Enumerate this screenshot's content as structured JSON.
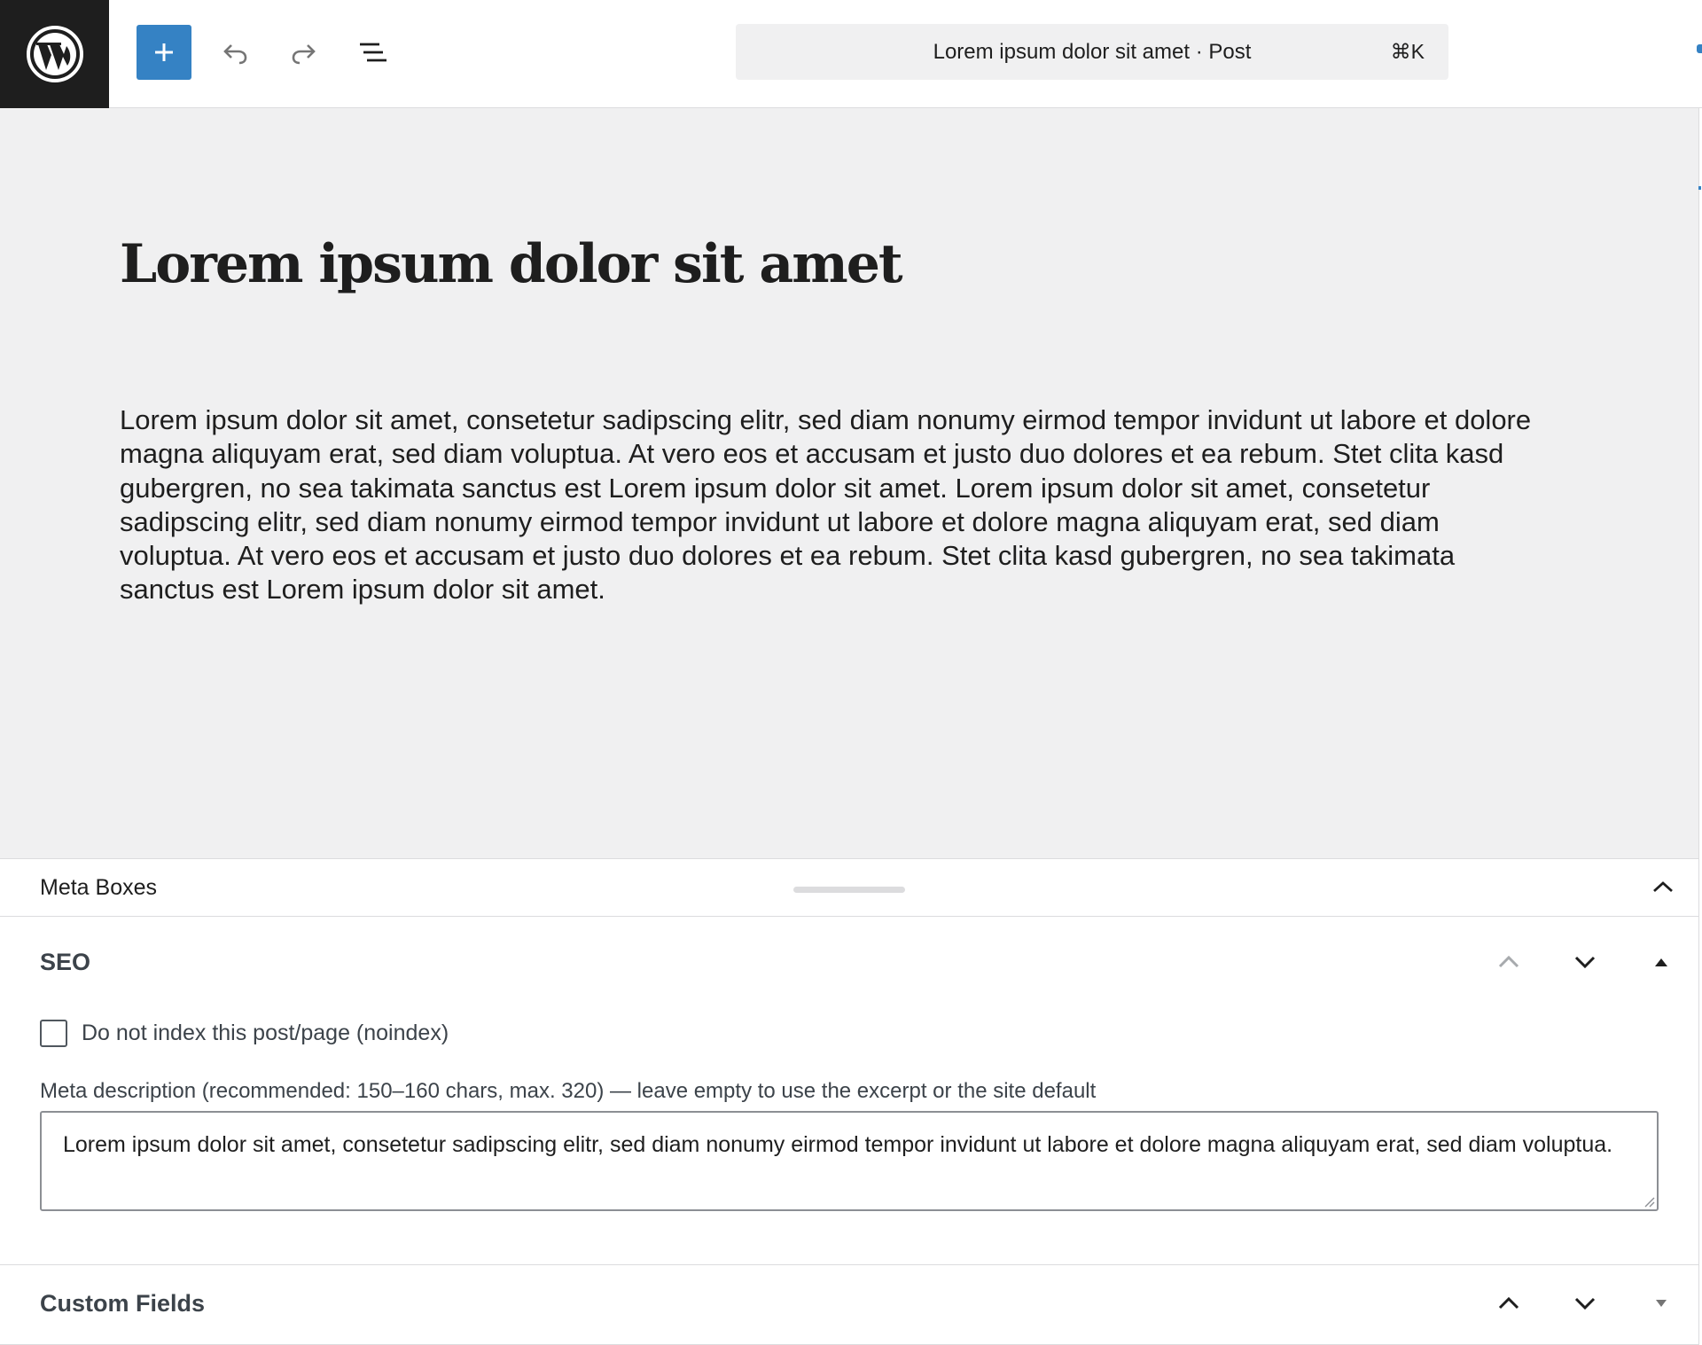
{
  "toolbar": {
    "logo_icon": "wordpress-logo",
    "add_block_icon": "plus-icon",
    "undo_icon": "undo-icon",
    "redo_icon": "redo-icon",
    "document_overview_icon": "list-view-icon",
    "command_title": "Lorem ipsum dolor sit amet · Post",
    "command_shortcut": "⌘K",
    "accent_color": "#3582c4"
  },
  "editor": {
    "post_title": "Lorem ipsum dolor sit amet",
    "post_body": "Lorem ipsum dolor sit amet, consetetur sadipscing elitr, sed diam nonumy eirmod tempor invidunt ut labore et dolore magna aliquyam erat, sed diam voluptua. At vero eos et accusam et justo duo dolores et ea rebum. Stet clita kasd gubergren, no sea takimata sanctus est Lorem ipsum dolor sit amet. Lorem ipsum dolor sit amet, consetetur sadipscing elitr, sed diam nonumy eirmod tempor invidunt ut labore et dolore magna aliquyam erat, sed diam voluptua. At vero eos et accusam et justo duo dolores et ea rebum. Stet clita kasd gubergren, no sea takimata sanctus est Lorem ipsum dolor sit amet."
  },
  "meta_boxes": {
    "title": "Meta Boxes",
    "toggle_icon": "chevron-up-icon",
    "seo": {
      "title": "SEO",
      "noindex_label": "Do not index this post/page (noindex)",
      "noindex_checked": false,
      "meta_description_label": "Meta description (recommended: 150–160 chars, max. 320) — leave empty to use the excerpt or the site default",
      "meta_description_value": "Lorem ipsum dolor sit amet, consetetur sadipscing elitr, sed diam nonumy eirmod tempor invidunt ut labore et dolore magna aliquyam erat, sed diam voluptua."
    },
    "custom_fields": {
      "title": "Custom Fields"
    }
  }
}
